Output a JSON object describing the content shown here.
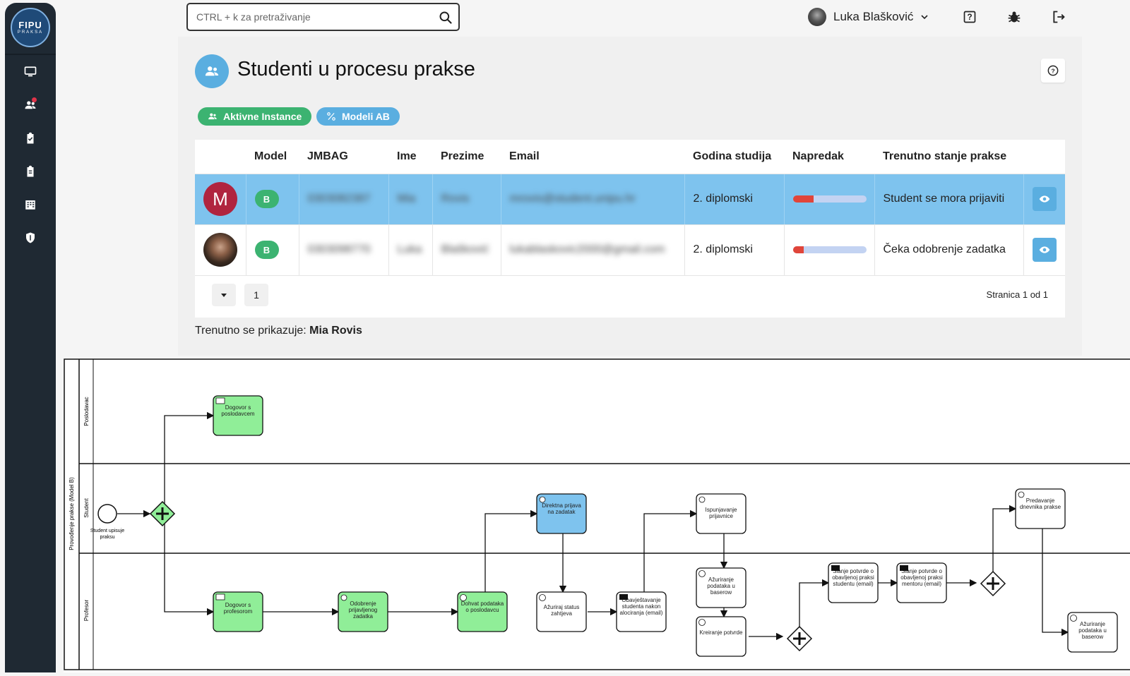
{
  "logo": {
    "line1": "FIPU",
    "line2": "PRAKSA"
  },
  "sidebar": {
    "items": [
      {
        "icon": "monitor-icon"
      },
      {
        "icon": "users-icon",
        "notification": true
      },
      {
        "icon": "clipboard-check-icon"
      },
      {
        "icon": "clipboard-list-icon"
      },
      {
        "icon": "building-icon"
      },
      {
        "icon": "shield-icon"
      }
    ]
  },
  "search": {
    "placeholder": "CTRL + k za pretraživanje"
  },
  "user": {
    "name": "Luka Blašković"
  },
  "page": {
    "title": "Studenti u procesu prakse"
  },
  "tabs": {
    "active_instances": "Aktivne Instance",
    "models": "Modeli AB"
  },
  "table": {
    "headers": [
      "",
      "Model",
      "JMBAG",
      "Ime",
      "Prezime",
      "Email",
      "Godina studija",
      "Napredak",
      "Trenutno stanje prakse",
      ""
    ],
    "rows": [
      {
        "avatar": "M",
        "model": "B",
        "jmbag": "0303082387",
        "ime": "Mia",
        "prezime": "Rovis",
        "email": "mrovis@student.unipu.hr",
        "godina": "2. diplomski",
        "progress": 0.28,
        "stanje": "Student se mora prijaviti",
        "selected": true
      },
      {
        "avatar": "",
        "model": "B",
        "jmbag": "0303098770",
        "ime": "Luka",
        "prezime": "Blašković",
        "email": "lukablaskovic2000@gmail.com",
        "godina": "2. diplomski",
        "progress": 0.15,
        "stanje": "Čeka odobrenje zadatka",
        "selected": false
      }
    ]
  },
  "pager": {
    "current": "1",
    "info": "Stranica 1 od 1"
  },
  "showing": {
    "label": "Trenutno se prikazuje:",
    "name": "Mia Rovis"
  },
  "bpmn": {
    "pool": "Provođenje prakse (Model B)",
    "lanes": [
      "Poslodavac",
      "Student",
      "Profesor"
    ],
    "start_event": "Student upisuje praksu",
    "tasks": {
      "t1": "Dogovor s poslodavcem",
      "t2": "Dogovor s profesorom",
      "t3": "Odobrenje prijavljenog zadatka",
      "t4": "Dohvat podataka o poslodavcu",
      "t5": "Direktna prijava na zadatak",
      "t6": "Ažuriraj status zahtjeva",
      "t7": "Obavještavanje studenta nakon alociranja (email)",
      "t8": "Ispunjavanje prijavnice",
      "t9": "Ažuriranje podataka u baserow",
      "t10": "Kreiranje potvrde",
      "t11": "Slanje potvrde o obavljenoj praksi studentu (email)",
      "t12": "Slanje potvrde o obavljenoj praksi mentoru (email)",
      "t13": "Predavanje dnevnika prakse",
      "t14": "Ažuriranje podataka u baserow"
    },
    "colors": {
      "done": "#90ee98",
      "active": "#7ec3ee",
      "pending": "#ffffff"
    }
  }
}
